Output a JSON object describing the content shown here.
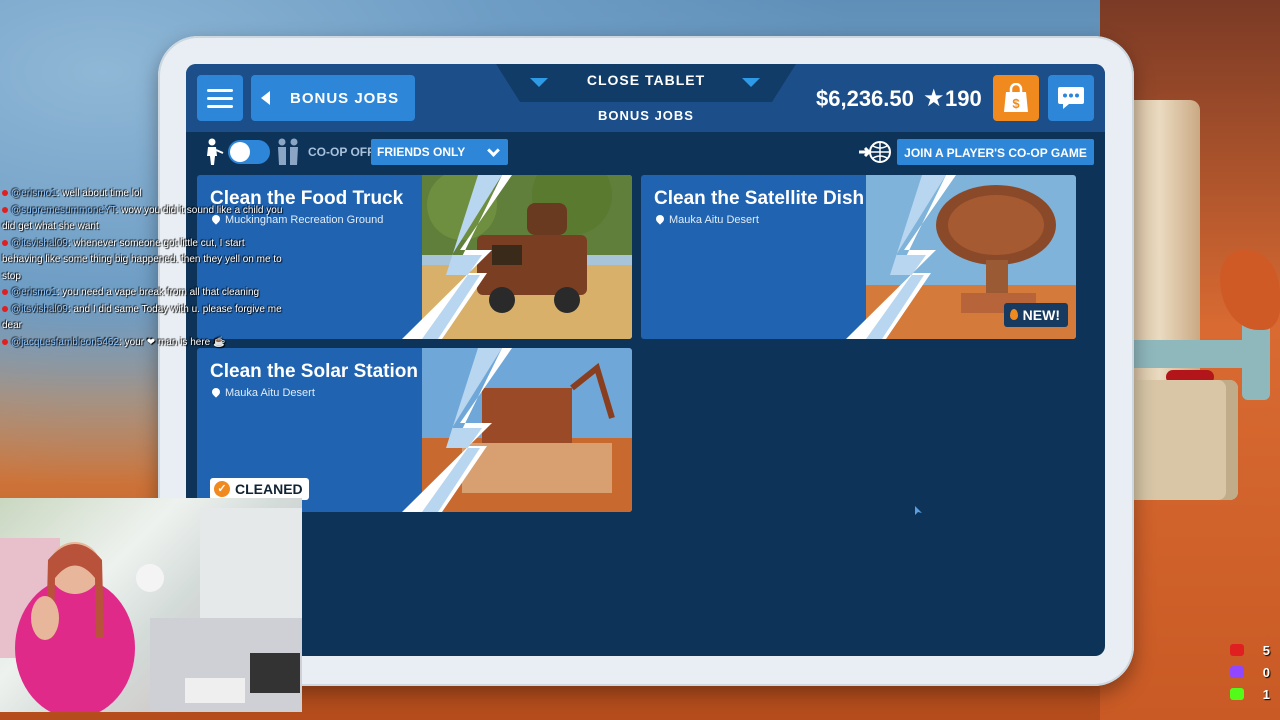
{
  "header": {
    "back_label": "BONUS JOBS",
    "close_label": "CLOSE TABLET",
    "subtitle": "BONUS JOBS",
    "money": "$6,236.50",
    "stars": "190"
  },
  "filters": {
    "coop_status": "CO-OP OFF",
    "visibility": "FRIENDS ONLY",
    "join_label": "JOIN A PLAYER'S CO-OP GAME"
  },
  "jobs": [
    {
      "title": "Clean the Food Truck",
      "location": "Muckingham Recreation Ground",
      "badge": ""
    },
    {
      "title": "Clean the Satellite Dish",
      "location": "Mauka Aitu Desert",
      "badge": "NEW!"
    },
    {
      "title": "Clean the Solar Station",
      "location": "Mauka Aitu Desert",
      "badge": "CLEANED"
    }
  ],
  "stream_chat": [
    {
      "user": "@erismo1",
      "text": ": well about time lol"
    },
    {
      "user": "@supremesummoneYT",
      "text": ": wow you did it sound like a child you did get what she want"
    },
    {
      "user": "@itsvishal09",
      "text": ": whenever someone got little cut, I start behaving like some thing big happened. then they yell on me to stop"
    },
    {
      "user": "@erismo1",
      "text": ": you need a vape break from all that cleaning"
    },
    {
      "user": "@itsvishal09",
      "text": ": and I did same Today with u. please forgive me dear"
    },
    {
      "user": "@jacquesfambleon5462",
      "text": ": your ❤ man is here ☕"
    }
  ],
  "stream_counters": [
    {
      "platform": "youtube-icon",
      "value": "5",
      "color": "#e02020"
    },
    {
      "platform": "twitch-icon",
      "value": "0",
      "color": "#9146ff"
    },
    {
      "platform": "kick-icon",
      "value": "1",
      "color": "#53fc18"
    }
  ],
  "colors": {
    "accent": "#2d86d8",
    "panel": "#1f63b1",
    "screen": "#0d3358",
    "shop": "#f08a1e"
  }
}
